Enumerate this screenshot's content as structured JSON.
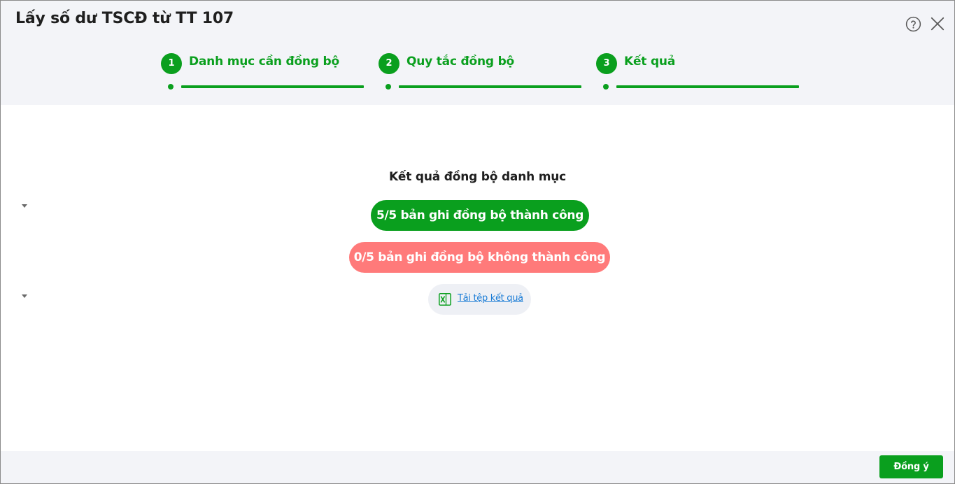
{
  "dialog": {
    "title": "Lấy số dư TSCĐ từ TT 107",
    "help_icon": "help-circle-icon",
    "close_icon": "close-icon"
  },
  "steps": [
    {
      "number": "1",
      "label": "Danh mục cần đồng bộ"
    },
    {
      "number": "2",
      "label": "Quy tắc đồng bộ"
    },
    {
      "number": "3",
      "label": "Kết quả"
    }
  ],
  "result": {
    "heading": "Kết quả đồng bộ danh mục",
    "success_text": "5/5 bản ghi đồng bộ thành công",
    "fail_text": "0/5 bản ghi đồng bộ không thành công",
    "download_label": "Tải tệp kết quả",
    "download_icon": "excel-file-icon"
  },
  "footer": {
    "ok_label": "Đồng ý"
  },
  "colors": {
    "accent": "#0a9f1e",
    "fail": "#ff7a7a",
    "link": "#1a7cd6",
    "header_bg": "#f3f4f8"
  }
}
